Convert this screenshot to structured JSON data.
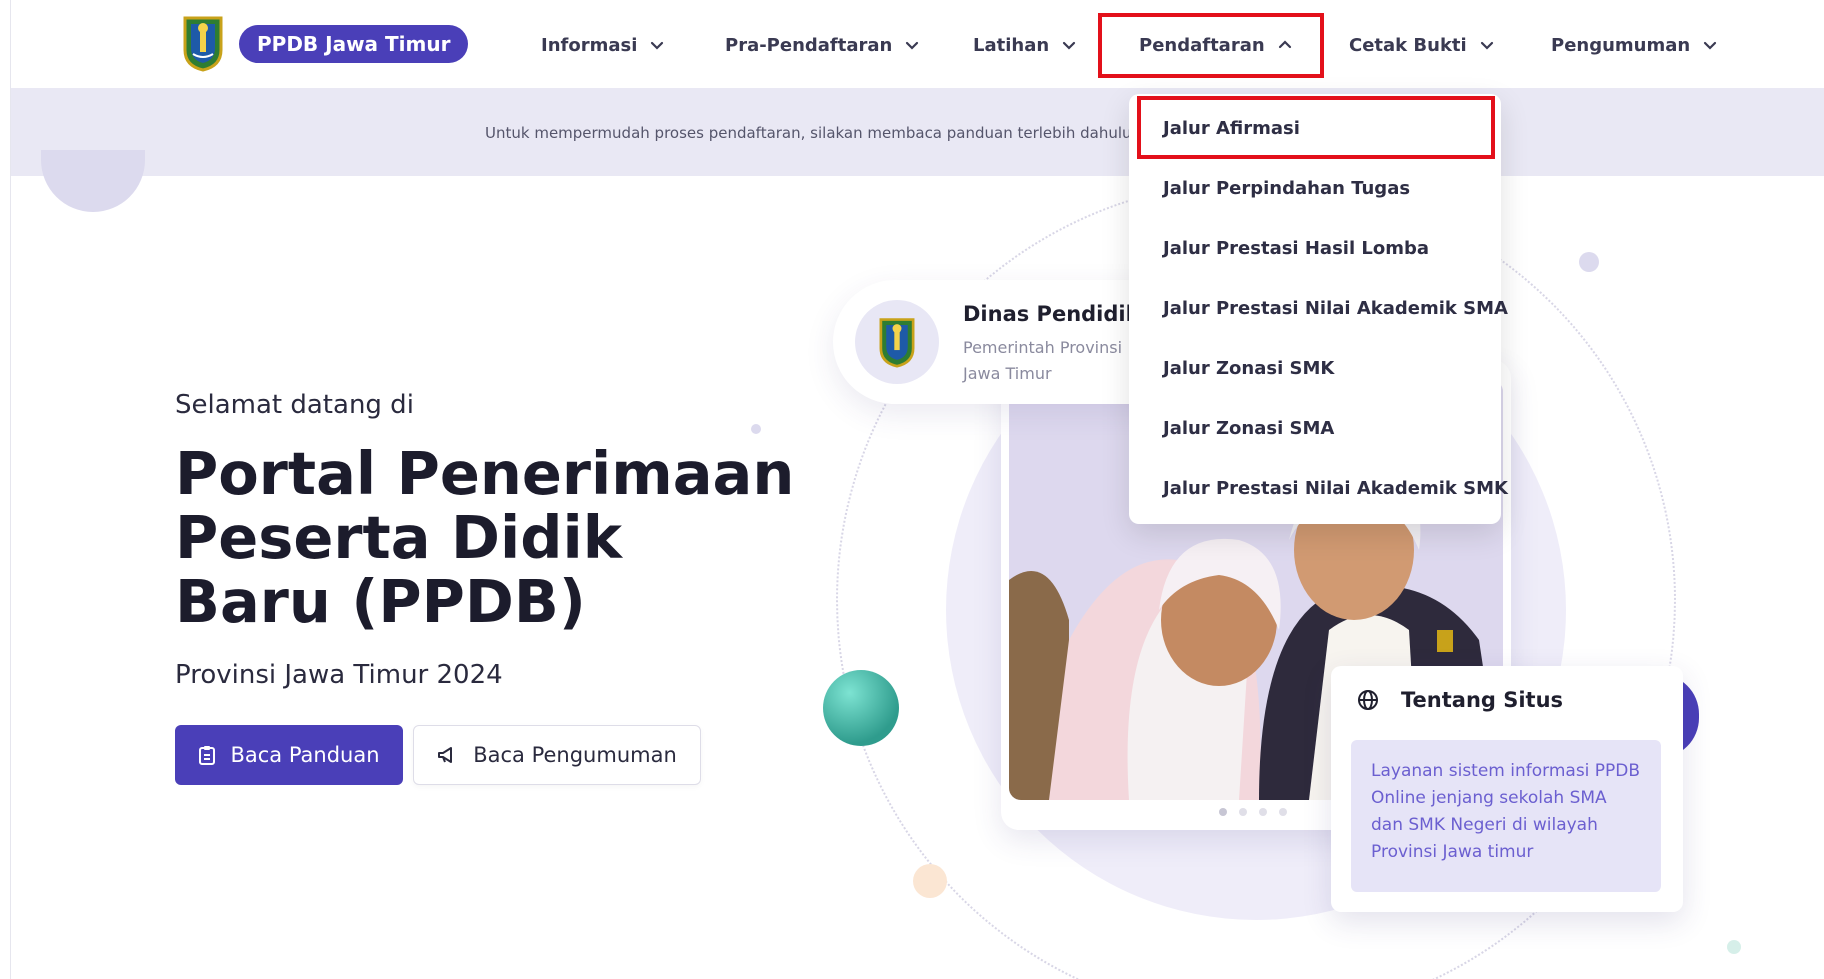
{
  "brand": {
    "label": "PPDB Jawa Timur"
  },
  "nav": [
    {
      "label": "Informasi"
    },
    {
      "label": "Pra-Pendaftaran"
    },
    {
      "label": "Latihan"
    },
    {
      "label": "Pendaftaran"
    },
    {
      "label": "Cetak Bukti"
    },
    {
      "label": "Pengumuman"
    }
  ],
  "banner": {
    "text": "Untuk mempermudah proses pendaftaran, silakan membaca panduan terlebih dahulu"
  },
  "hero": {
    "welcome": "Selamat datang di",
    "title": "Portal Penerimaan Peserta Didik Baru (PPDB)",
    "subtitle": "Provinsi Jawa Timur 2024",
    "primary_button": "Baca Panduan",
    "secondary_button": "Baca Pengumuman"
  },
  "dinas_card": {
    "title": "Dinas Pendidikan",
    "subtitle": "Pemerintah Provinsi Jawa Timur"
  },
  "tentang": {
    "title": "Tentang Situs",
    "body": "Layanan sistem informasi PPDB Online jenjang sekolah SMA dan SMK Negeri di wilayah Provinsi Jawa timur"
  },
  "dropdown": {
    "items": [
      {
        "label": "Jalur Afirmasi"
      },
      {
        "label": "Jalur Perpindahan Tugas"
      },
      {
        "label": "Jalur Prestasi Hasil Lomba"
      },
      {
        "label": "Jalur Prestasi Nilai Akademik SMA"
      },
      {
        "label": "Jalur Zonasi SMK"
      },
      {
        "label": "Jalur Zonasi SMA"
      },
      {
        "label": "Jalur Prestasi Nilai Akademik SMK"
      }
    ]
  },
  "icons": {
    "logo": "east-java-emblem-icon",
    "chevron": "chevron-down-icon",
    "chevron_open": "chevron-up-icon",
    "guide": "clipboard-icon",
    "announcement": "megaphone-icon",
    "about": "globe-icon"
  },
  "colors": {
    "brand": "#4a3fb8",
    "highlight": "#e3101a",
    "banner_bg": "#e9e8f4",
    "tentang_bg": "#e6e4f7"
  }
}
